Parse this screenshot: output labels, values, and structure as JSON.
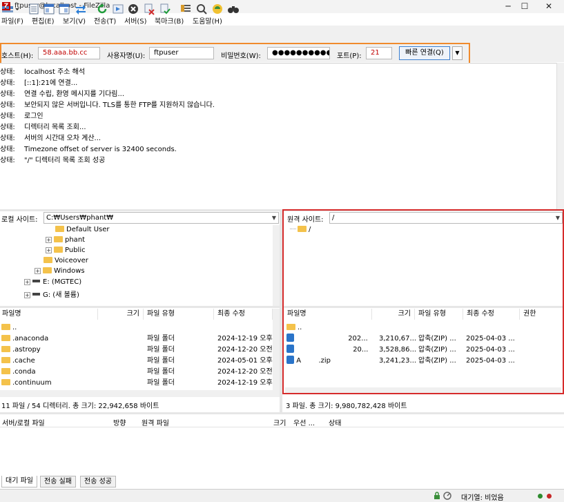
{
  "window": {
    "title": "ftpuser@localhost - FileZilla",
    "minimize": "─",
    "maximize": "☐",
    "close": "✕"
  },
  "menu": [
    "파일(F)",
    "편집(E)",
    "보기(V)",
    "전송(T)",
    "서버(S)",
    "북마크(B)",
    "도움말(H)"
  ],
  "toolbar_icons": [
    "site-manager-icon",
    "dropdown-arrow-icon",
    "toggle-log-icon",
    "toggle-local-tree-icon",
    "toggle-remote-tree-icon",
    "toggle-queue-icon",
    "refresh-icon",
    "process-queue-icon",
    "cancel-icon",
    "disconnect-icon",
    "reconnect-icon",
    "filter-icon",
    "search-files-icon",
    "compare-icon",
    "binoculars-icon"
  ],
  "quickconnect": {
    "host_label": "호스트(H):",
    "host_value": "58.aaa.bb.cc",
    "user_label": "사용자명(U):",
    "user_value": "ftpuser",
    "pass_label": "비밀번호(W):",
    "pass_value": "●●●●●●●●●●",
    "port_label": "포트(P):",
    "port_value": "21",
    "connect_button": "빠른 연결(Q)",
    "arrow": "▼"
  },
  "log": {
    "prefix": "상태:",
    "lines": [
      "localhost 주소 해석",
      "[::1]:21에 연결...",
      "연결 수립, 환영 메시지를 기다림...",
      "보안되지 않은 서버입니다. TLS를 통한 FTP를 지원하지 않습니다.",
      "로그인",
      "디렉터리 목록 조회...",
      "서버의 시간대 오차 계산...",
      "Timezone offset of server is 32400 seconds.",
      "\"/\" 디렉터리 목록 조회 성공"
    ]
  },
  "local": {
    "site_label": "로컬 사이트:",
    "path": "C:₩Users₩phant₩",
    "tree": [
      "Default User",
      "phant",
      "Public",
      "Voiceover",
      "Windows",
      "E: (MGTEC)",
      "G: (새 볼륨)"
    ],
    "columns": [
      "파일명",
      "크기",
      "파일 유형",
      "최종 수정"
    ],
    "files": [
      {
        "name": "..",
        "size": "",
        "type": "",
        "modified": ""
      },
      {
        "name": ".anaconda",
        "size": "",
        "type": "파일 폴더",
        "modified": "2024-12-19 오후"
      },
      {
        "name": ".astropy",
        "size": "",
        "type": "파일 폴더",
        "modified": "2024-12-20 오전"
      },
      {
        "name": ".cache",
        "size": "",
        "type": "파일 폴더",
        "modified": "2024-05-01 오후"
      },
      {
        "name": ".conda",
        "size": "",
        "type": "파일 폴더",
        "modified": "2024-12-20 오전"
      },
      {
        "name": ".continuum",
        "size": "",
        "type": "파일 폴더",
        "modified": "2024-12-19 오후"
      }
    ],
    "status": "11 파일 / 54 디렉터리. 총 크기: 22,942,658 바이트"
  },
  "remote": {
    "site_label": "원격 사이트:",
    "path": "/",
    "tree": [
      "/"
    ],
    "columns": [
      "파일명",
      "크기",
      "파일 유형",
      "최종 수정",
      "권한"
    ],
    "files": [
      {
        "name": "..",
        "size": "",
        "type": "",
        "modified": ""
      },
      {
        "name": "202...",
        "size": "3,210,67...",
        "type": "압축(ZIP) ...",
        "modified": "2025-04-03 ..."
      },
      {
        "name": "20...",
        "size": "3,528,86...",
        "type": "압축(ZIP) ...",
        "modified": "2025-04-03 ..."
      },
      {
        "name": "A        .zip",
        "size": "3,241,23...",
        "type": "압축(ZIP) ...",
        "modified": "2025-04-03 ..."
      }
    ],
    "status": "3 파일. 총 크기: 9,980,782,428 바이트"
  },
  "queue": {
    "columns": [
      "서버/로컬 파일",
      "방향",
      "원격 파일",
      "크기",
      "우선 ...",
      "상태"
    ],
    "tabs": [
      "대기 파일",
      "전송 실패",
      "전송 성공"
    ],
    "status_text": "대기열: 비었음"
  },
  "colors": {
    "highlight_orange": "#f08a2c",
    "highlight_red": "#d62b2b",
    "field_text_red": "#c00000"
  }
}
